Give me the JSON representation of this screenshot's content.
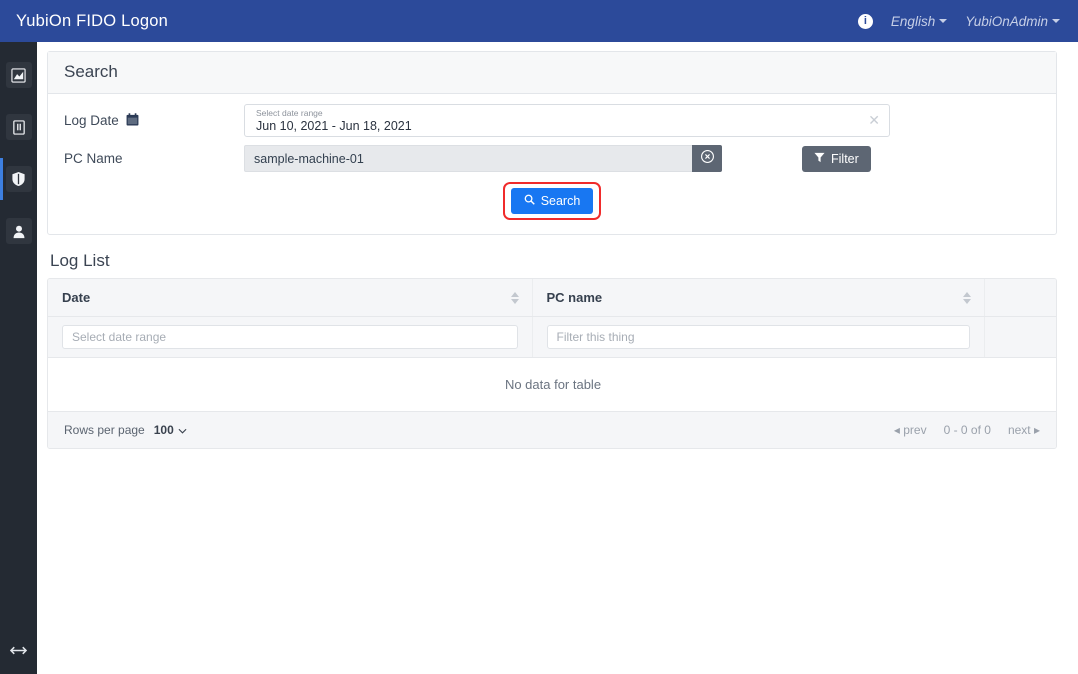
{
  "navbar": {
    "brand": "YubiOn FIDO Logon",
    "info_icon": "info-icon",
    "language": "English",
    "account": "YubiOnAdmin"
  },
  "sidebar": {
    "items": [
      {
        "icon": "chart-icon",
        "name": "dashboard"
      },
      {
        "icon": "book-icon",
        "name": "log"
      },
      {
        "icon": "shield-icon",
        "name": "security",
        "active": true
      },
      {
        "icon": "user-icon",
        "name": "users"
      }
    ],
    "collapse_icon": "arrows-left-right-icon"
  },
  "search_card": {
    "title": "Search",
    "log_date": {
      "label": "Log Date",
      "icon": "calendar-icon",
      "float_label": "Select date range",
      "value": "Jun 10, 2021 - Jun 18, 2021",
      "clear_icon": "close-icon"
    },
    "pc_name": {
      "label": "PC Name",
      "value": "sample-machine-01",
      "clear_icon": "circle-x-icon"
    },
    "filter_button": {
      "label": "Filter",
      "icon": "funnel-icon"
    },
    "search_button": {
      "label": "Search",
      "icon": "search-icon",
      "highlight_color": "#f02b2b",
      "color": "#1877f2"
    }
  },
  "log_list": {
    "title": "Log List",
    "columns": [
      {
        "label": "Date",
        "sortable": true
      },
      {
        "label": "PC name",
        "sortable": true
      },
      {
        "label": "",
        "sortable": false
      }
    ],
    "filters": [
      {
        "placeholder": "Select date range"
      },
      {
        "placeholder": "Filter this thing"
      }
    ],
    "empty_message": "No data for table",
    "footer": {
      "rows_per_page_label": "Rows per page",
      "rows_per_page_value": "100",
      "prev_label": "prev",
      "range_label": "0 - 0 of 0",
      "next_label": "next"
    }
  }
}
